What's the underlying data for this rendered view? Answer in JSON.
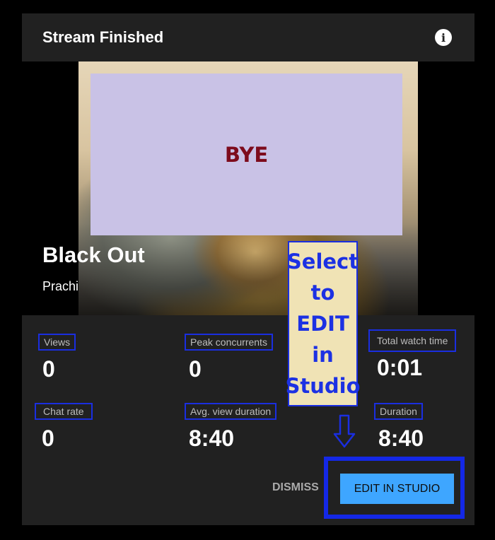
{
  "header": {
    "title": "Stream Finished",
    "info_icon": "info-icon"
  },
  "preview": {
    "card_text": "BYE",
    "stream_title": "Black Out",
    "channel_name": "Prachi"
  },
  "stats": {
    "views_label": "Views",
    "views_value": "0",
    "peak_label": "Peak concurrents",
    "peak_value": "0",
    "total_watch_label": "Total watch time",
    "total_watch_value": "0:01",
    "chat_rate_label": "Chat rate",
    "chat_rate_value": "0",
    "avg_duration_label": "Avg. view duration",
    "avg_duration_value": "8:40",
    "duration_label": "Duration",
    "duration_value": "8:40"
  },
  "actions": {
    "dismiss_label": "DISMISS",
    "edit_label": "EDIT IN STUDIO"
  },
  "annotation": {
    "lines": [
      "Select",
      "to",
      "EDIT",
      "in",
      "Studio"
    ],
    "arrow_icon": "arrow-down-icon"
  },
  "colors": {
    "header_bg": "#212121",
    "panel_bg": "#212121",
    "primary_button": "#3ea6ff",
    "annotation_blue": "#1a2ee0",
    "annotation_fill": "#f0e3b5",
    "card_fill": "#c9c2e6",
    "card_text": "#7d0b1c"
  }
}
